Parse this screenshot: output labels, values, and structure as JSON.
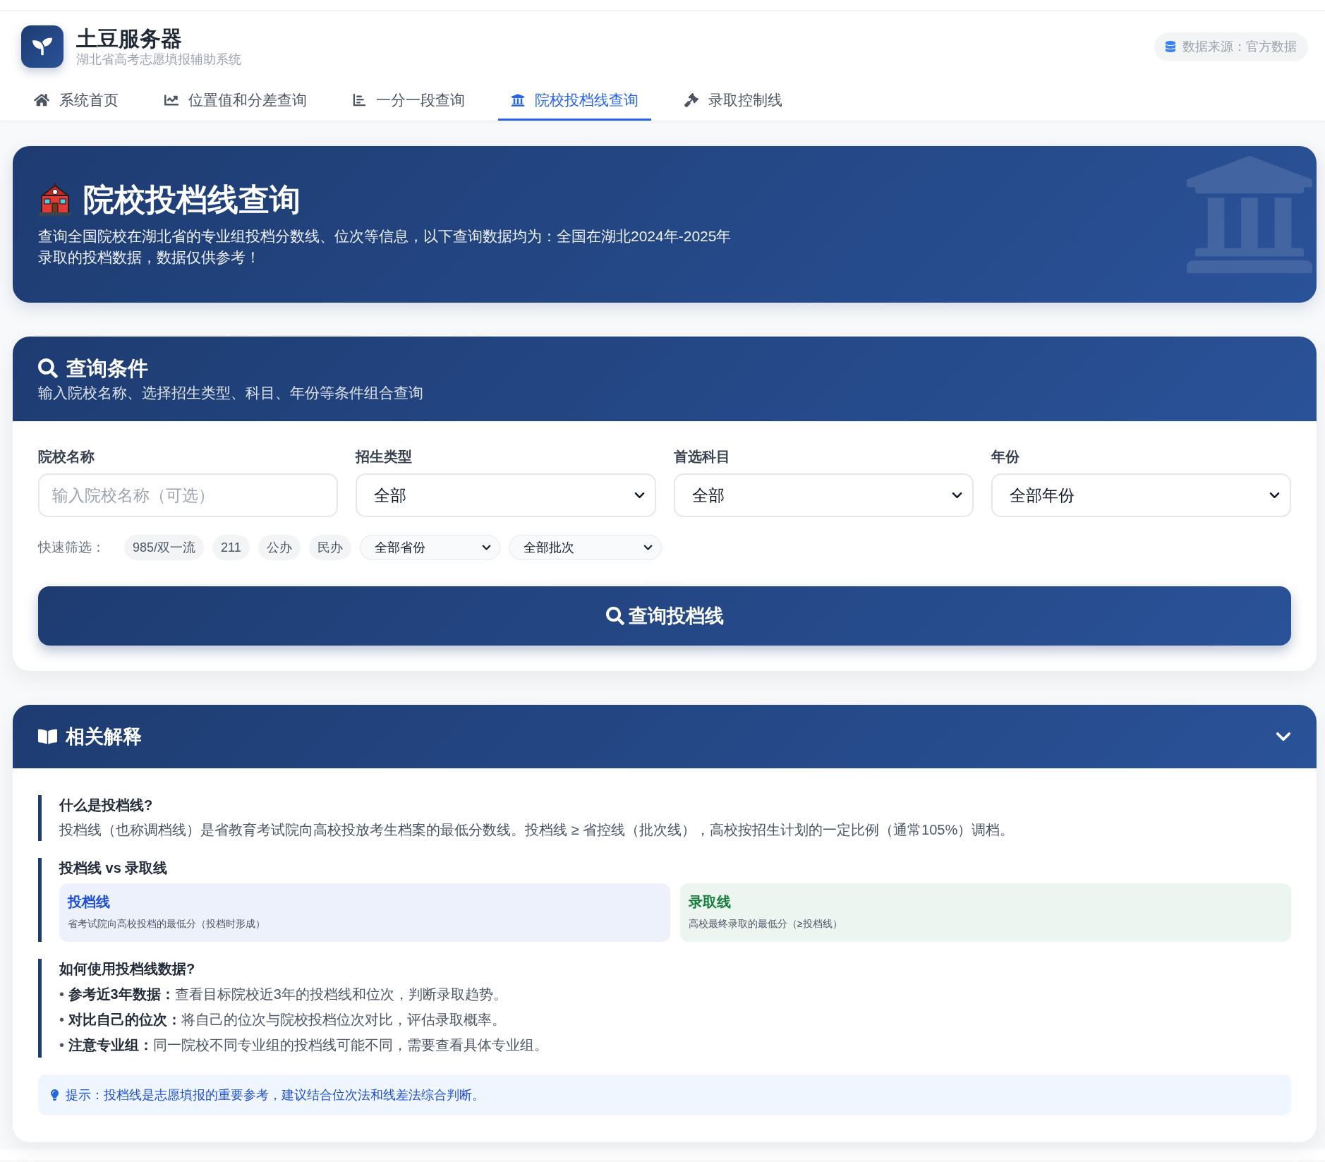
{
  "header": {
    "app_title": "土豆服务器",
    "app_subtitle": "湖北省高考志愿填报辅助系统",
    "data_source": "数据来源：官方数据"
  },
  "nav": {
    "tabs": [
      {
        "label": "系统首页",
        "selected": false
      },
      {
        "label": "位置值和分差查询",
        "selected": false
      },
      {
        "label": "一分一段查询",
        "selected": false
      },
      {
        "label": "院校投档线查询",
        "selected": true
      },
      {
        "label": "录取控制线",
        "selected": false
      }
    ]
  },
  "banner": {
    "title": "院校投档线查询",
    "description": "查询全国院校在湖北省的专业组投档分数线、位次等信息，以下查询数据均为：全国在湖北2024年-2025年录取的投档数据，数据仅供参考！"
  },
  "query_card": {
    "title": "查询条件",
    "subtitle": "输入院校名称、选择招生类型、科目、年份等条件组合查询",
    "fields": [
      {
        "kind": "input",
        "label": "院校名称",
        "placeholder": "输入院校名称（可选）"
      },
      {
        "kind": "select",
        "label": "招生类型",
        "value": "全部"
      },
      {
        "kind": "select",
        "label": "首选科目",
        "value": "全部"
      },
      {
        "kind": "select",
        "label": "年份",
        "value": "全部年份"
      }
    ],
    "quick_filter": {
      "label": "快速筛选：",
      "chips": [
        "985/双一流",
        "211",
        "公办",
        "民办"
      ],
      "selects": [
        "全部省份",
        "全部批次"
      ]
    },
    "submit_button": "查询投档线"
  },
  "explanation_card": {
    "title": "相关解释",
    "expanded": true,
    "sections": [
      {
        "kind": "text",
        "title": "什么是投档线?",
        "body": "投档线（也称调档线）是省教育考试院向高校投放考生档案的最低分数线。投档线 ≥ 省控线（批次线），高校按招生计划的一定比例（通常105%）调档。"
      },
      {
        "kind": "compare",
        "title": "投档线 vs 录取线",
        "items": [
          {
            "title": "投档线",
            "text": "省考试院向高校投档的最低分（投档时形成）",
            "color": "#1d4ed8"
          },
          {
            "title": "录取线",
            "text": "高校最终录取的最低分（≥投档线）",
            "color": "#15803d"
          }
        ]
      },
      {
        "kind": "list",
        "title": "如何使用投档线数据?",
        "items": [
          "• **参考近3年数据：**查看目标院校近3年的投档线和位次，判断录取趋势。",
          "• **对比自己的位次：**将自己的位次与院校投档位次对比，评估录取概率。",
          "• **注意专业组：**同一院校不同专业组的投档线可能不同，需要查看具体专业组。"
        ]
      }
    ],
    "tip": "提示：投档线是志愿填报的重要参考，建议结合位次法和线差法综合判断。"
  }
}
